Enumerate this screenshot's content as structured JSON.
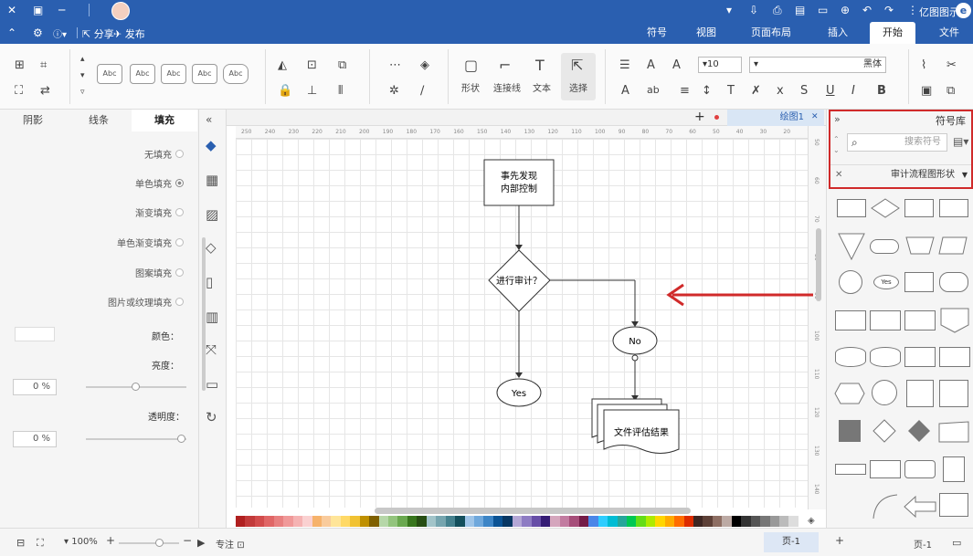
{
  "titlebar": {
    "app_title": "亿图图示",
    "right_icons": [
      "app-logo-icon",
      "history-icon",
      "undo-icon",
      "redo-icon",
      "new-icon",
      "open-icon",
      "save-icon",
      "print-icon",
      "export-icon",
      "more-icon"
    ],
    "window_controls": [
      "close-icon",
      "maximize-icon",
      "minimize-icon"
    ]
  },
  "tabbar": {
    "tabs": [
      "文件",
      "开始",
      "插入",
      "页面布局",
      "视图",
      "符号"
    ],
    "active_tab": "开始",
    "publish_label": "发布",
    "share_label": "分享"
  },
  "ribbon": {
    "groups": {
      "select_label": "选择",
      "text_label": "文本",
      "connector_label": "连接线",
      "shape_label": "形状"
    },
    "font": {
      "family": "黑体",
      "size": "10"
    },
    "style_samples": [
      "Abc",
      "Abc",
      "Abc",
      "Abc",
      "Abc",
      "Abc"
    ]
  },
  "left_panel": {
    "tabs": [
      "填充",
      "线条",
      "阴影"
    ],
    "active_tab": "填充",
    "fill_options": [
      "无填充",
      "单色填充",
      "渐变填充",
      "单色渐变填充",
      "图案填充",
      "图片或纹理填充"
    ],
    "selected_fill": "单色填充",
    "color_label": "颜色：",
    "brightness_label": "亮度：",
    "brightness_value": "0 %",
    "transparency_label": "透明度：",
    "transparency_value": "0 %"
  },
  "document": {
    "tab_name": "绘图1",
    "add_tab": "+"
  },
  "ruler": {
    "h_ticks": [
      "10",
      "20",
      "30",
      "40",
      "50",
      "60",
      "70",
      "80",
      "90",
      "100",
      "110",
      "120",
      "130",
      "140",
      "150",
      "160",
      "170",
      "180",
      "190",
      "200",
      "210",
      "220",
      "230",
      "240",
      "250"
    ],
    "v_ticks": [
      "50",
      "60",
      "70",
      "80",
      "90",
      "100",
      "110",
      "120",
      "130",
      "140"
    ]
  },
  "flowchart": {
    "start_box": "事先发现\n内部控制",
    "decision": "进行审计？",
    "no_label": "No",
    "yes_label": "Yes",
    "document": "文件评估结果"
  },
  "library": {
    "title": "符号库",
    "search_placeholder": "搜索符号",
    "category": "审计流程图形状"
  },
  "palette": [
    "#b02020",
    "#c23a3a",
    "#d24c4c",
    "#e06666",
    "#e88080",
    "#f09999",
    "#f5b3b3",
    "#fad1d1",
    "#f6b26b",
    "#f9cb9c",
    "#ffe599",
    "#ffd966",
    "#f1c232",
    "#bf9000",
    "#7f6000",
    "#b6d7a8",
    "#93c47d",
    "#6aa84f",
    "#38761d",
    "#274e13",
    "#a2c4c9",
    "#76a5af",
    "#45818e",
    "#134f5c",
    "#9fc5e8",
    "#6fa8dc",
    "#3d85c6",
    "#0b5394",
    "#073763",
    "#b4a7d6",
    "#8e7cc3",
    "#674ea7",
    "#351c75",
    "#d5a6bd",
    "#c27ba0",
    "#a64d79",
    "#741b47",
    "#4a86e8",
    "#2ecdff",
    "#00bcd4",
    "#26a69a",
    "#00c853",
    "#64dd17",
    "#aeea00",
    "#ffd600",
    "#ffab00",
    "#ff6d00",
    "#dd2c00",
    "#3e2723",
    "#5d4037",
    "#8d6e63",
    "#bcaaa4",
    "#000000",
    "#333333",
    "#555555",
    "#777777",
    "#999999",
    "#bbbbbb",
    "#dddddd",
    "#ffffff"
  ],
  "status": {
    "page_label": "页-1",
    "page_tab": "页-1",
    "add_page": "+",
    "focus_label": "专注",
    "zoom": "100%"
  }
}
